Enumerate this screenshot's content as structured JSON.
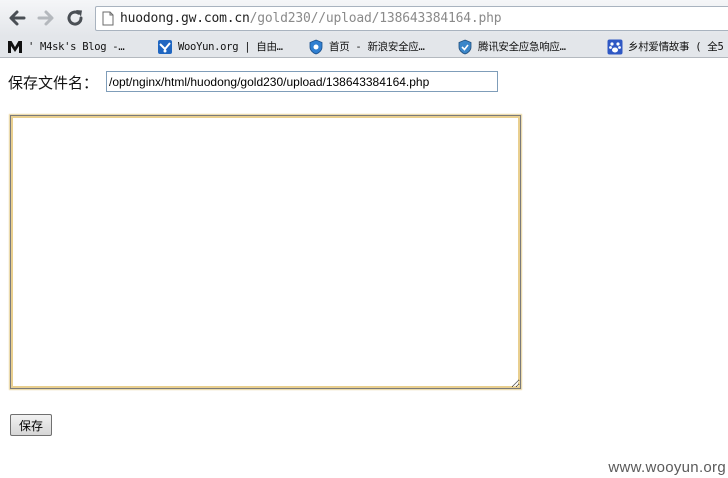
{
  "browser": {
    "url_host": "huodong.gw.com.cn",
    "url_path": "/gold230//upload/138643384164.php",
    "bookmarks": [
      {
        "icon": "m-logo-icon",
        "label": "'  M4sk's Blog -…"
      },
      {
        "icon": "wooyun-logo-icon",
        "label": "WooYun.org | 自由…"
      },
      {
        "icon": "shield-icon",
        "label": "首页 - 新浪安全应…"
      },
      {
        "icon": "tencent-security-icon",
        "label": "腾讯安全应急响应…"
      },
      {
        "icon": "baidu-paw-icon",
        "label": "乡村爱情故事 ( 全5"
      }
    ]
  },
  "form": {
    "filename_label": "保存文件名：",
    "filename_value": "/opt/nginx/html/huodong/gold230/upload/138643384164.php",
    "content_value": "",
    "save_label": "保存"
  },
  "watermark": "www.wooyun.org",
  "colors": {
    "textarea_focus": "#e9cf8f",
    "input_border": "#7f9db9",
    "chrome_bg": "#e3e6ea"
  }
}
